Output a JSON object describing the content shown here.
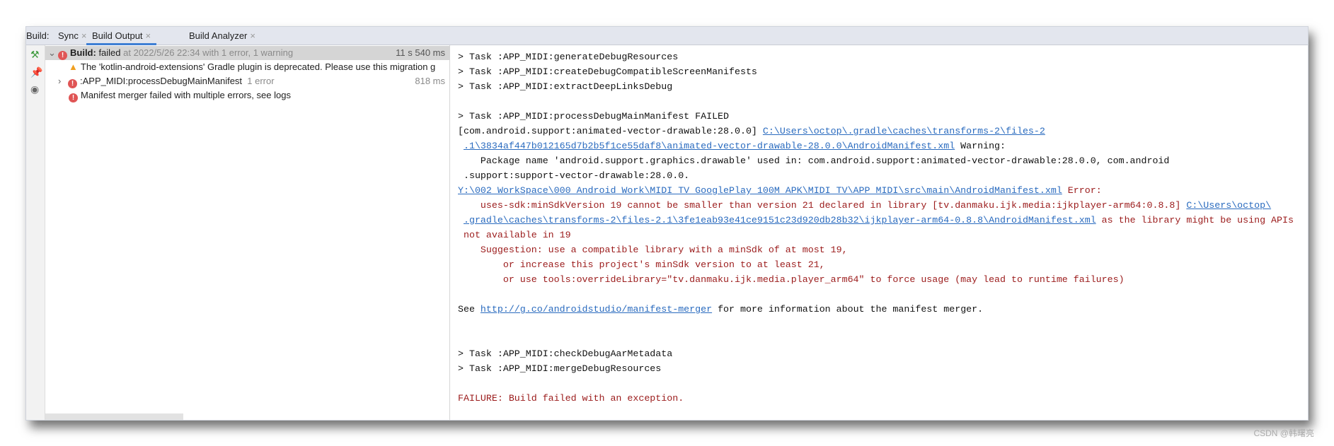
{
  "tabbar": {
    "label": "Build:",
    "tabs": [
      {
        "label": "Sync"
      },
      {
        "label": "Build Output"
      },
      {
        "label": "Build Analyzer"
      }
    ],
    "close": "×",
    "active": "Build Output"
  },
  "toolstrip": {
    "icons": [
      "hammer-icon",
      "pin-icon",
      "eye-icon"
    ]
  },
  "tree": {
    "root": {
      "bold": "Build:",
      "status": " failed",
      "detail": " at 2022/5/26 22:34 with 1 error, 1 warning",
      "time": "11 s 540 ms"
    },
    "warning": "The 'kotlin-android-extensions' Gradle plugin is deprecated. Please use this migration g",
    "task": {
      "label": ":APP_MIDI:processDebugMainManifest",
      "detail": "1 error",
      "time": "818 ms"
    },
    "error": "Manifest merger failed with multiple errors, see logs"
  },
  "console": {
    "l1": "> Task :APP_MIDI:generateDebugResources",
    "l2": "> Task :APP_MIDI:createDebugCompatibleScreenManifests",
    "l3": "> Task :APP_MIDI:extractDeepLinksDebug",
    "l4": "> Task :APP_MIDI:processDebugMainManifest FAILED",
    "l5a": "[com.android.support:animated-vector-drawable:28.0.0] ",
    "l5b": "C:\\Users\\octop\\.gradle\\caches\\transforms-2\\files-2",
    "l6a": ".1\\3834af447b012165d7b2b5f1ce55daf8\\animated-vector-drawable-28.0.0\\AndroidManifest.xml",
    "l6b": " Warning:",
    "l7": "    Package name 'android.support.graphics.drawable' used in: com.android.support:animated-vector-drawable:28.0.0, com.android",
    "l8": " .support:support-vector-drawable:28.0.0.",
    "l9a": "Y:\\002 WorkSpace\\000 Android Work\\MIDI TV GooglePlay 100M APK\\MIDI TV\\APP MIDI\\src\\main\\AndroidManifest.xml",
    "l9b": " Error:",
    "l10a": "    uses-sdk:minSdkVersion 19 cannot be smaller than version 21 declared in library [tv.danmaku.ijk.media:ijkplayer-arm64:0.8.8] ",
    "l10b": "C:\\Users\\octop\\",
    "l11a": ".gradle\\caches\\transforms-2\\files-2.1\\3fe1eab93e41ce9151c23d920db28b32\\ijkplayer-arm64-0.8.8\\AndroidManifest.xml",
    "l11b": " as the library might be using APIs",
    "l12": " not available in 19",
    "l13": "    Suggestion: use a compatible library with a minSdk of at most 19,",
    "l14": "        or increase this project's minSdk version to at least 21,",
    "l15": "        or use tools:overrideLibrary=\"tv.danmaku.ijk.media.player_arm64\" to force usage (may lead to runtime failures)",
    "l16a": "See ",
    "l16b": "http://g.co/androidstudio/manifest-merger",
    "l16c": " for more information about the manifest merger.",
    "l17": "> Task :APP_MIDI:checkDebugAarMetadata",
    "l18": "> Task :APP_MIDI:mergeDebugResources",
    "l19": "FAILURE: Build failed with an exception."
  },
  "watermark": "CSDN @韩曙亮",
  "colors": {
    "link": "#2a6bbf",
    "error": "#9b1b1b",
    "accent": "#3f7fd4"
  }
}
